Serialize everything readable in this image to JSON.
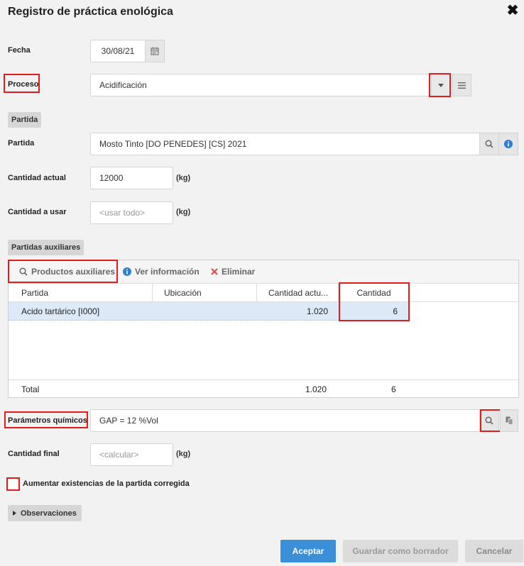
{
  "dialog": {
    "title": "Registro de práctica enológica",
    "close_glyph": "✖"
  },
  "fecha": {
    "label": "Fecha",
    "value": "30/08/21"
  },
  "proceso": {
    "label": "Proceso",
    "value": "Acidificación"
  },
  "partida_section": {
    "label": "Partida"
  },
  "partida": {
    "label": "Partida",
    "value": "Mosto Tinto [DO PENEDES] [CS] 2021"
  },
  "cantidad_actual": {
    "label": "Cantidad actual",
    "value": "12000",
    "unit": "(kg)"
  },
  "cantidad_usar": {
    "label": "Cantidad a usar",
    "placeholder": "<usar todo>",
    "unit": "(kg)"
  },
  "aux_section": {
    "label": "Partidas auxiliares"
  },
  "toolbar": {
    "productos": "Productos auxiliares",
    "info": "Ver información",
    "eliminar": "Eliminar"
  },
  "grid": {
    "columns": [
      "Partida",
      "Ubicación",
      "Cantidad actu...",
      "Cantidad"
    ],
    "rows": [
      {
        "partida": "Acido tartárico [I000]",
        "ubicacion": "",
        "cantidad_actual": "1.020",
        "cantidad": "6"
      }
    ],
    "total": {
      "label": "Total",
      "cantidad_actual": "1.020",
      "cantidad": "6"
    }
  },
  "parametros": {
    "label": "Parámetros químicos",
    "value": "GAP = 12 %Vol"
  },
  "cantidad_final": {
    "label": "Cantidad final",
    "placeholder": "<calcular>",
    "unit": "(kg)"
  },
  "aumentar": {
    "label": "Aumentar existencias de la partida corregida"
  },
  "observaciones": {
    "label": "Observaciones"
  },
  "buttons": {
    "aceptar": "Aceptar",
    "guardar": "Guardar como borrador",
    "cancelar": "Cancelar"
  },
  "colors": {
    "accent": "#3a8fd9",
    "highlight": "#e21b1b",
    "info": "#2f7fd1",
    "delete": "#e04b4b"
  }
}
